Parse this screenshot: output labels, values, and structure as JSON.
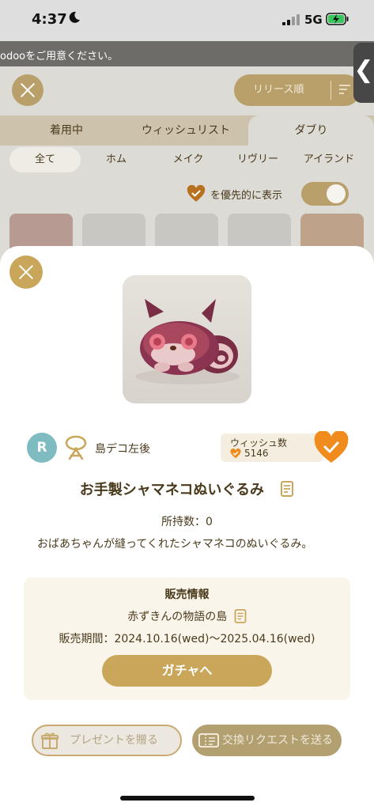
{
  "status_bar": {
    "time": "4:37",
    "network": "5G",
    "icons": [
      "moon-icon",
      "signal-icon",
      "battery-charging-icon"
    ]
  },
  "background": {
    "banner_text": "odooをご用意ください。",
    "sort_label": "リリース順",
    "main_tabs": [
      "着用中",
      "ウィッシュリスト",
      "ダブり"
    ],
    "active_main_tab": "ダブり",
    "sub_tabs": [
      "全て",
      "ホム",
      "メイク",
      "リヴリー",
      "アイランド"
    ],
    "active_sub_tab": "全て",
    "priority_label": "を優先的に表示",
    "priority_toggle_on": true,
    "side_tab_glyph": "❮"
  },
  "modal": {
    "rarity": "R",
    "category_label": "島デコ左後",
    "wish_label": "ウィッシュ数",
    "wish_count": "5146",
    "wished": true,
    "item_name": "お手製シャマネコぬいぐるみ",
    "owned_count": "所持数：0",
    "description": "おばあちゃんが縫ってくれたシャマネコのぬいぐるみ。",
    "sale": {
      "heading": "販売情報",
      "location": "赤ずきんの物語の島",
      "period": "販売期間：2024.10.16(wed)〜2025.04.16(wed)",
      "button_label": "ガチャへ"
    },
    "gift_button_label": "プレゼントを贈る",
    "trade_button_label": "交換リクエストを送る"
  },
  "colors": {
    "accent_gold": "#c9a65a",
    "wish_orange": "#f08c1e",
    "rarity_teal": "#7fbcc1",
    "text_brown": "#4a3a1c"
  }
}
